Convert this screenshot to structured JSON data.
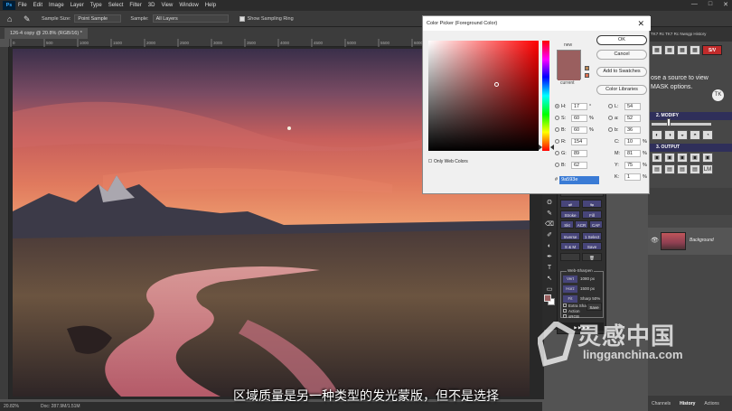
{
  "menubar": {
    "logo": "Ps",
    "items": [
      "File",
      "Edit",
      "Image",
      "Layer",
      "Type",
      "Select",
      "Filter",
      "3D",
      "View",
      "Window",
      "Help"
    ],
    "window_controls": [
      "—",
      "□",
      "✕"
    ]
  },
  "options": {
    "sample_size_label": "Sample Size:",
    "sample_size_value": "Point Sample",
    "sample_label": "Sample:",
    "sample_value": "All Layers",
    "show_ring_label": "Show Sampling Ring"
  },
  "document": {
    "tab_title": "126-4 copy @ 20.8% (RGB/16) *",
    "zoom": "20.82%",
    "doc_info": "Doc: 287.9M/1.51M",
    "ruler_ticks": [
      "0",
      "500",
      "1000",
      "1500",
      "2000",
      "2500",
      "3000",
      "3500",
      "4000",
      "4500",
      "5000",
      "5500",
      "6000",
      "6500",
      "7000",
      "7500",
      "8000"
    ]
  },
  "subtitle": "区域质量是另一种类型的发光蒙版，但不是选择",
  "color_picker": {
    "title": "Color Picker (Foreground Color)",
    "close": "✕",
    "new_label": "new",
    "current_label": "current",
    "buttons": {
      "ok": "OK",
      "cancel": "Cancel",
      "add_swatches": "Add to Swatches",
      "color_libraries": "Color Libraries"
    },
    "hsb": [
      {
        "label": "H:",
        "value": "17",
        "unit": "°"
      },
      {
        "label": "S:",
        "value": "60",
        "unit": "%"
      },
      {
        "label": "B:",
        "value": "60",
        "unit": "%"
      }
    ],
    "rgb": [
      {
        "label": "R:",
        "value": "154"
      },
      {
        "label": "G:",
        "value": "89"
      },
      {
        "label": "B:",
        "value": "62"
      }
    ],
    "lab": [
      {
        "label": "L:",
        "value": "54"
      },
      {
        "label": "a:",
        "value": "52"
      },
      {
        "label": "b:",
        "value": "36"
      }
    ],
    "cmyk": [
      {
        "label": "C:",
        "value": "10",
        "unit": "%"
      },
      {
        "label": "M:",
        "value": "81",
        "unit": "%"
      },
      {
        "label": "Y:",
        "value": "75",
        "unit": "%"
      },
      {
        "label": "K:",
        "value": "1",
        "unit": "%"
      }
    ],
    "web_only_label": "Only Web Colors",
    "hex_label": "#",
    "hex_value": "9a593e",
    "swatch_color": "#9a5f5f"
  },
  "tools": [
    "⇱",
    "⬚",
    "ʘ",
    "✎",
    "⌫",
    "✐",
    "◐",
    "✒",
    "T",
    "↖",
    "▭",
    "✋",
    "🔍",
    "⋯"
  ],
  "actions_panel": {
    "buttons": [
      "Stroke",
      "Fill",
      "Skt",
      "ACR",
      "CAF",
      "Inverse",
      "1 Select",
      "S & M",
      "Save"
    ],
    "web_sharpen_title": "Web-Sharpen",
    "vert_label": "Vert",
    "vert_value": "1080",
    "vert_unit": "px",
    "horz_label": "Horz",
    "horz_value": "1500",
    "horz_unit": "px",
    "fit_label": "Fit",
    "sharp_label": "Sharp",
    "sharp_value": "50",
    "sharp_unit": "%",
    "extra_sharp": "Extra Sharp",
    "action": "Action",
    "srgb": "sRGB",
    "save": "Save"
  },
  "right_panel": {
    "top_tabs": "TK7 Rc  TK7 Rc  Nwsgp  History",
    "text_line1": "ose a source to view",
    "text_line2": "MASK options.",
    "tag": "TK",
    "sav_label": "S/V",
    "modify_label": "2. MODIFY",
    "output_label": "3. OUTPUT",
    "lm_label": "LM",
    "layer_name": "Background",
    "bottom_tabs": [
      "Channels",
      "History",
      "Actions"
    ]
  },
  "watermark": {
    "text": "灵感中国",
    "url": "lingganchina.com"
  },
  "colors": {
    "sav_red": "#c02b2b",
    "action_blue": "#47457a",
    "hex_blue": "#3a7bd5"
  }
}
